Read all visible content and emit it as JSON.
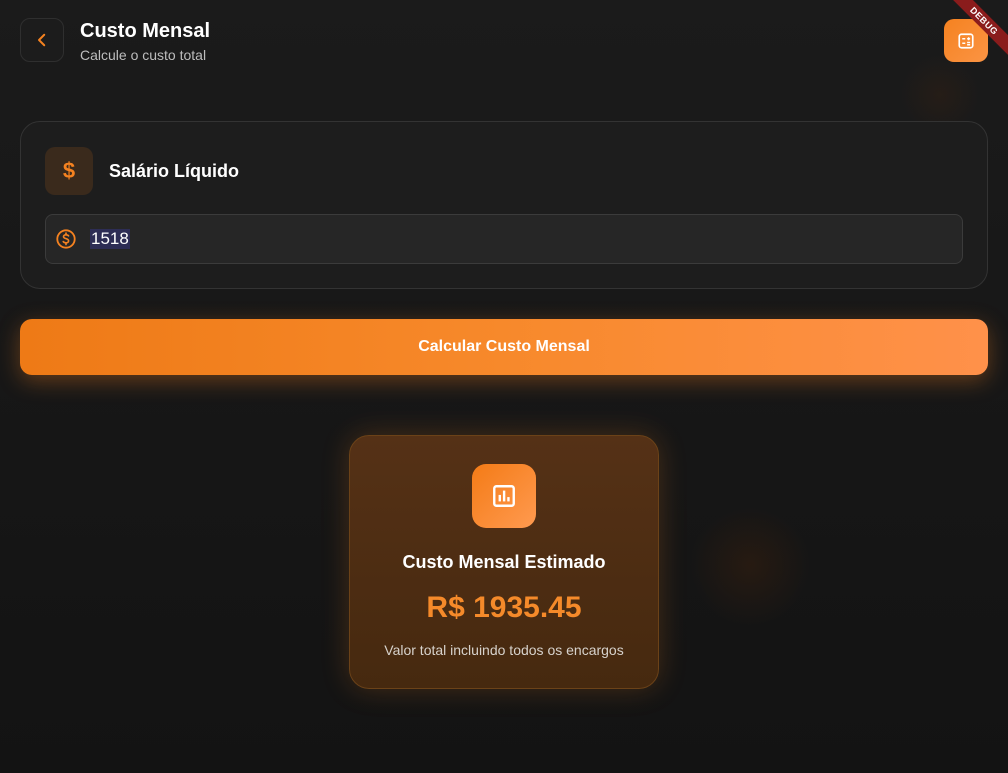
{
  "header": {
    "title": "Custo Mensal",
    "subtitle": "Calcule o custo total",
    "back_icon": "chevron-left-icon",
    "calculator_icon": "calculator-icon"
  },
  "debug_banner": "DEBUG",
  "input_card": {
    "icon": "$",
    "label": "Salário Líquido",
    "field_icon": "coin-dollar-icon",
    "value": "1518"
  },
  "action": {
    "label": "Calcular Custo Mensal"
  },
  "result": {
    "icon": "bar-chart-icon",
    "title": "Custo Mensal Estimado",
    "value": "R$ 1935.45",
    "note": "Valor total incluindo todos os encargos"
  },
  "colors": {
    "accent": "#f58220",
    "background": "#151515",
    "card": "#1d1d1d",
    "result_card": "#4e2e13"
  }
}
